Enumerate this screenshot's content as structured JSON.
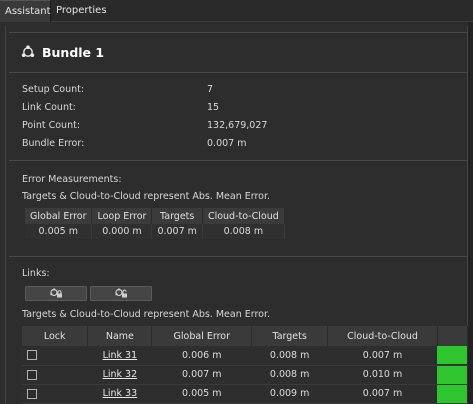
{
  "tabs": [
    "Assistant",
    "Properties"
  ],
  "header": {
    "title": "Bundle 1",
    "icon": "bundle-icon"
  },
  "properties": [
    {
      "label": "Setup Count:",
      "value": "7"
    },
    {
      "label": "Link Count:",
      "value": "15"
    },
    {
      "label": "Point Count:",
      "value": "132,679,027"
    },
    {
      "label": "Bundle Error:",
      "value": "0.007 m"
    }
  ],
  "error_section": {
    "heading": "Error Measurements:",
    "note": "Targets & Cloud-to-Cloud represent Abs. Mean Error.",
    "columns": [
      "Global Error",
      "Loop Error",
      "Targets",
      "Cloud-to-Cloud"
    ],
    "values": [
      "0.005 m",
      "0.000 m",
      "0.007 m",
      "0.008 m"
    ]
  },
  "links_section": {
    "heading": "Links:",
    "buttons": [
      {
        "name": "link-lock-button",
        "icon": "lock-link-icon"
      },
      {
        "name": "link-unlock-button",
        "icon": "unlock-link-icon"
      }
    ],
    "note": "Targets & Cloud-to-Cloud represent Abs. Mean Error.",
    "columns": [
      "Lock",
      "Name",
      "Global Error",
      "Targets",
      "Cloud-to-Cloud",
      ""
    ],
    "rows": [
      {
        "name": "Link 31",
        "global_error": "0.006 m",
        "targets": "0.008 m",
        "cloud": "0.007 m",
        "status_color": "#2ec52e"
      },
      {
        "name": "Link 32",
        "global_error": "0.007 m",
        "targets": "0.008 m",
        "cloud": "0.010 m",
        "status_color": "#2ec52e"
      },
      {
        "name": "Link 33",
        "global_error": "0.005 m",
        "targets": "0.009 m",
        "cloud": "0.007 m",
        "status_color": "#2ec52e"
      }
    ]
  },
  "colors": {
    "status_ok": "#2ec52e",
    "background": "#2d2d2d"
  }
}
